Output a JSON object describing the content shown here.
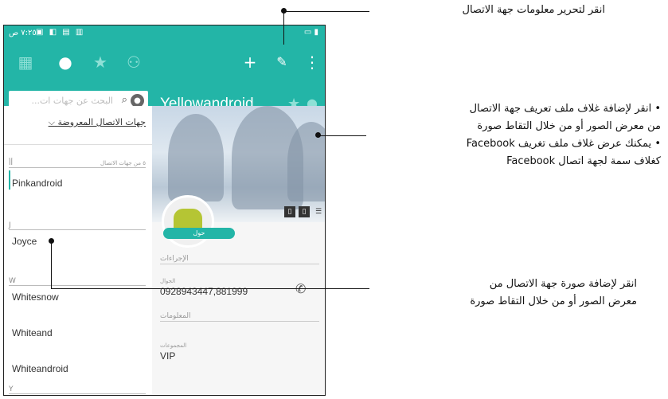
{
  "status_bar": {
    "time": "٧:٢٥ ص",
    "icons": [
      "wifi-icon",
      "signal-icon",
      "battery-icon"
    ]
  },
  "toolbar": {
    "icons": [
      "grid-icon",
      "person-icon",
      "star-icon",
      "group-icon",
      "plus-icon",
      "edit-pencil-icon",
      "overflow-menu-icon"
    ]
  },
  "search": {
    "placeholder": "البحث عن جهات ات..."
  },
  "contact": {
    "name": "Yellowandroid"
  },
  "list": {
    "filter_label": "جهات الاتصال المعروضة",
    "count_label": "٥ من جهات الاتصال",
    "sections": [
      {
        "letter": "أأ",
        "items": [
          "Pinkandroid"
        ]
      },
      {
        "letter": "J",
        "items": [
          "Joyce"
        ]
      },
      {
        "letter": "W",
        "items": [
          "Whitesnow",
          "Whiteand",
          "Whiteandroid"
        ]
      },
      {
        "letter": "Y",
        "items": []
      }
    ]
  },
  "details": {
    "tab_label": "حول",
    "actions_heading": "الإجراءات",
    "phone_label": "الجوال",
    "phone_value": "0928943447,881999",
    "info_heading": "المعلومات",
    "groups_label": "المجموعات",
    "groups_value": "VIP"
  },
  "annotations": {
    "edit_note": "انقر لتحرير معلومات جهة الاتصال",
    "cover_note_1a": "انقر لإضافة غلاف ملف تعريف جهة الاتصال",
    "cover_note_1b": "من معرض الصور أو من خلال التقاط صورة",
    "cover_note_2a": "يمكنك عرض غلاف ملف تغريف Facebook",
    "cover_note_2b": "كغلاف سمة لجهة اتصال Facebook",
    "photo_note_a": "انقر لإضافة صورة جهة الاتصال من",
    "photo_note_b": "معرض الصور أو من خلال التقاط صورة"
  },
  "colors": {
    "accent": "#23b5a7",
    "avatar_android": "#b5c534"
  }
}
